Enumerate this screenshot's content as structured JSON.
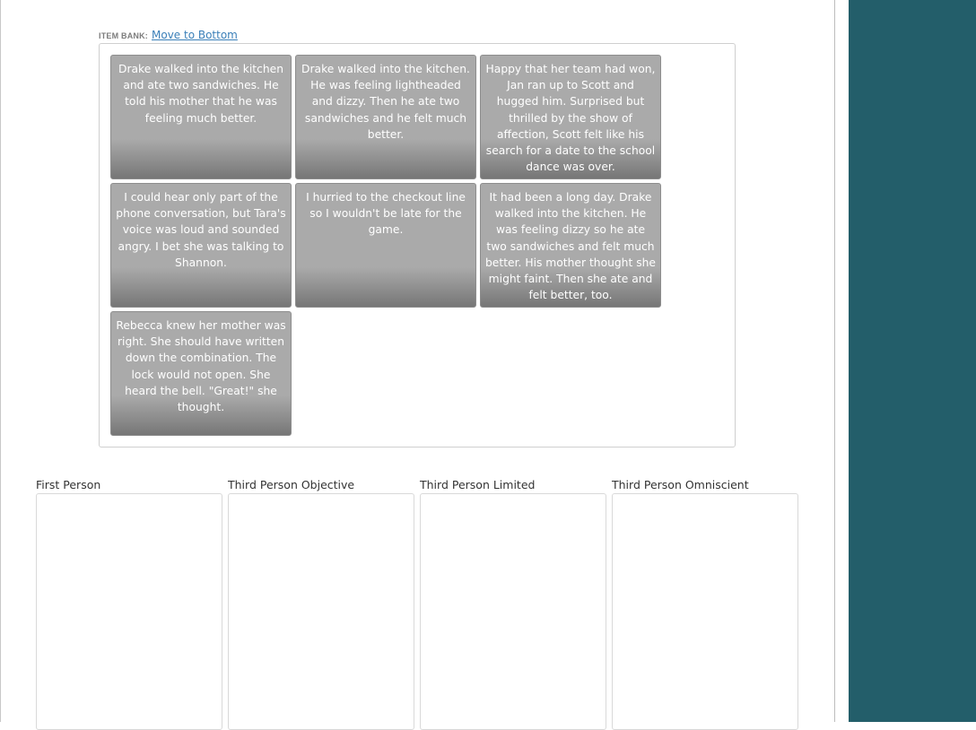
{
  "item_bank": {
    "label": "ITEM BANK:",
    "move_link": "Move to Bottom",
    "items": [
      "Drake walked into the kitchen and ate two sandwiches. He told his mother that he was feeling much better.",
      "Drake walked into the kitchen. He was feeling lightheaded and dizzy. Then he ate two sandwiches and he felt much better.",
      "Happy that her team had won, Jan ran up to Scott and hugged him. Surprised but thrilled by the show of affection, Scott felt like his search for a date to the school dance was over.",
      "I could hear only part of the phone conversation, but Tara's voice was loud and sounded angry. I bet she was talking to Shannon.",
      "I hurried to the checkout line so I wouldn't be late for the game.",
      "It had been a long day. Drake walked into the kitchen. He was feeling dizzy so he ate two sandwiches and felt much better. His mother thought she might faint. Then she ate and felt better, too.",
      "Rebecca knew her mother was right. She should have written down the combination. The lock would not open. She heard the bell. \"Great!\" she thought."
    ]
  },
  "categories": [
    "First Person",
    "Third Person Objective",
    "Third Person Limited",
    "Third Person Omniscient"
  ],
  "colors": {
    "tile_bg": "#aaaaaa",
    "tile_text": "#ffffff",
    "link": "#3a7fb8",
    "side_panel": "#235e6a"
  }
}
